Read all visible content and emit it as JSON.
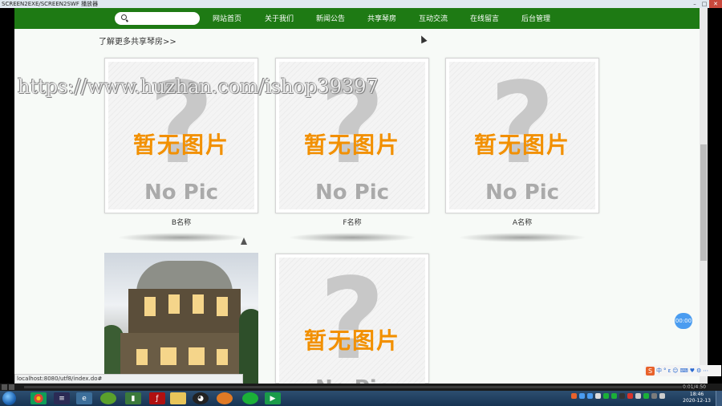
{
  "window": {
    "title": "SCREEN2EXE/SCREEN2SWF 播放器",
    "min": "–",
    "max": "□",
    "close": "✕"
  },
  "nav": {
    "search_placeholder": "",
    "items": [
      "网站首页",
      "关于我们",
      "新闻公告",
      "共享琴房",
      "互动交流",
      "在线留言",
      "后台管理"
    ]
  },
  "section": {
    "more_link": "了解更多共享琴房>>"
  },
  "placeholder": {
    "qmark": "?",
    "text_cn": "暂无图片",
    "text_en": "No Pic"
  },
  "cards": [
    {
      "name": "B名称"
    },
    {
      "name": "F名称"
    },
    {
      "name": "A名称"
    }
  ],
  "status_url": "localhost:8080/utf8/index.do#",
  "float_badge": "00:00",
  "ime": {
    "logo": "S",
    "items": [
      "中",
      "°",
      "ε",
      "☺",
      "⌨",
      "♥",
      "⚙",
      "⋯"
    ]
  },
  "player": {
    "time": "0:01/4:50"
  },
  "watermark": "https://www.huzhan.com/ishop39397",
  "clock": {
    "time": "18:46",
    "date": "2020-12-13"
  },
  "colors": {
    "nav_green": "#1e7a14",
    "accent_orange": "#f29000",
    "badge_blue": "#4a9cf0"
  }
}
